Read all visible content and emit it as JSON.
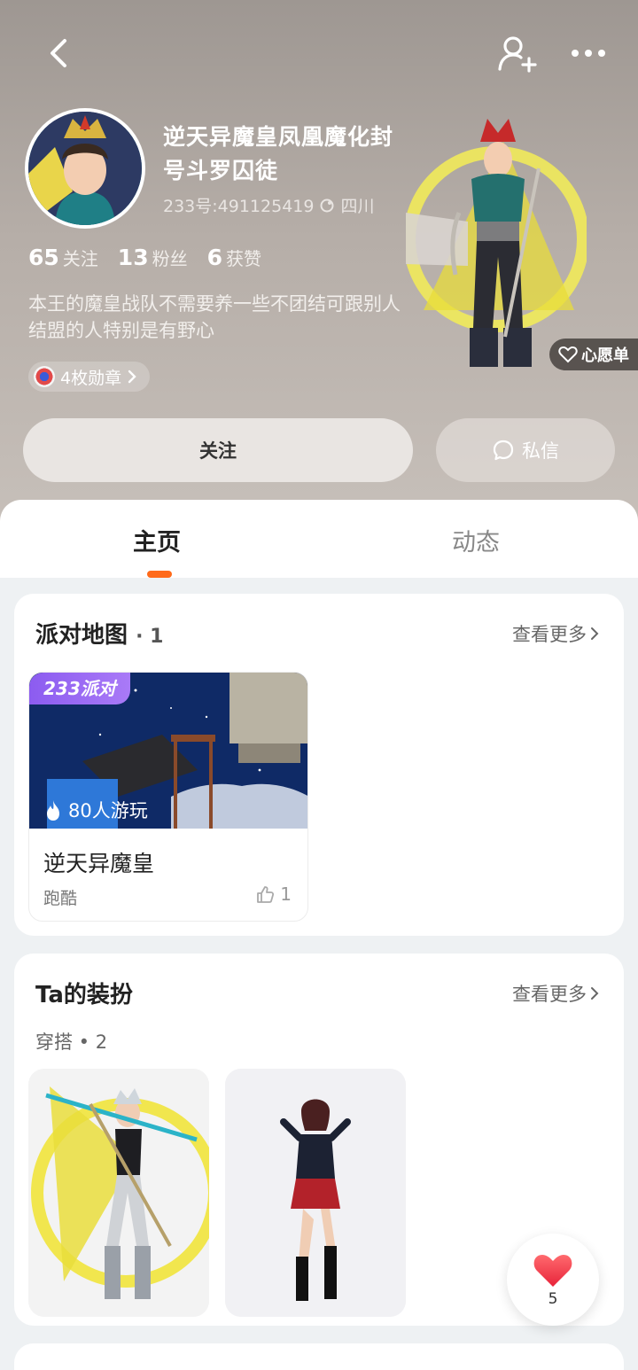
{
  "header": {
    "name": "逆天异魔皇凤凰魔化封号斗罗囚徒",
    "id_text": "233号:491125419",
    "location": "四川",
    "stats": [
      {
        "num": "65",
        "label": "关注"
      },
      {
        "num": "13",
        "label": "粉丝"
      },
      {
        "num": "6",
        "label": "获赞"
      }
    ],
    "bio": "本王的魔皇战队不需要养一些不团结可跟别人结盟的人特别是有野心",
    "badges_label": "4枚勋章",
    "wishlist_label": "心愿单",
    "follow_label": "关注",
    "message_label": "私信"
  },
  "icons": {
    "back": "chevron-left-icon",
    "add_friend": "user-plus-icon",
    "more": "more-dots-icon",
    "location": "location-icon",
    "heart": "heart-outline-icon",
    "chat": "chat-bubble-icon",
    "fire": "flame-icon",
    "thumb": "thumbs-up-icon"
  },
  "tabs": [
    {
      "label": "主页",
      "active": true
    },
    {
      "label": "动态",
      "active": false
    }
  ],
  "party_maps": {
    "title": "派对地图",
    "count": "· 1",
    "see_more": "查看更多",
    "items": [
      {
        "tag": "233派对",
        "players": "80人游玩",
        "name": "逆天异魔皇",
        "genre": "跑酷",
        "likes": "1"
      }
    ]
  },
  "outfits": {
    "title": "Ta的装扮",
    "see_more": "查看更多",
    "subtitle": "穿搭 • 2"
  },
  "like_fab": {
    "count": "5"
  },
  "colors": {
    "accent": "#ff6a1a",
    "tag_purple": "#8c5cf0",
    "heart_red": "#f23b4d"
  }
}
